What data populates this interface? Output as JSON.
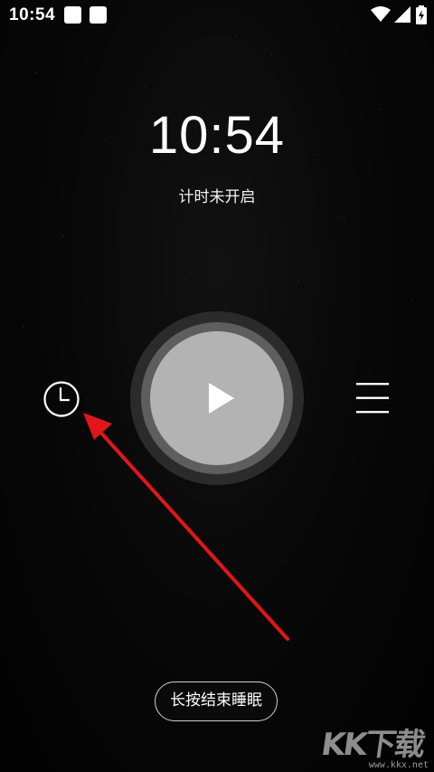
{
  "status_bar": {
    "time": "10:54"
  },
  "clock": {
    "time": "10:54",
    "timer_status": "计时未开启"
  },
  "controls": {
    "timer_icon": "clock-icon",
    "play_icon": "play-icon",
    "menu_icon": "menu-icon"
  },
  "end_sleep_button": {
    "label": "长按结束睡眠"
  },
  "watermark": {
    "logo": "KK下载",
    "url": "www.kkx.net"
  },
  "colors": {
    "background": "#000000",
    "play_inner": "#b3b3b3",
    "play_ring": "#5e5e5e",
    "play_outer": "#2b2b2b",
    "annotation_arrow": "#e0161b"
  }
}
